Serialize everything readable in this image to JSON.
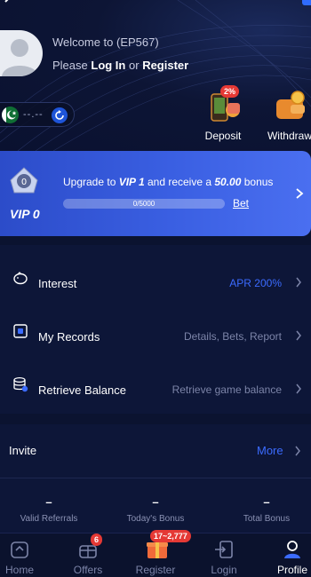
{
  "header": {
    "welcome": "Welcome to (EP567)",
    "please": "Please",
    "login": "Log In",
    "or": "or",
    "register": "Register",
    "balance": "--.--",
    "actions": [
      {
        "label": "Deposit",
        "badge": "2%"
      },
      {
        "label": "Withdraw"
      }
    ]
  },
  "vip": {
    "level": "VIP 0",
    "text_prefix": "Upgrade to",
    "next_level": "VIP 1",
    "text_mid": "and receive a",
    "bonus": "50.00",
    "text_suffix": "bonus",
    "progress_text": "0/5000",
    "progress_fraction": 0.0,
    "bet_label": "Bet"
  },
  "menu": [
    {
      "label": "Interest",
      "value": "APR 200%",
      "accent": true
    },
    {
      "label": "My Records",
      "value": "Details, Bets, Report",
      "accent": false
    },
    {
      "label": "Retrieve Balance",
      "value": "Retrieve game balance",
      "accent": false
    }
  ],
  "invite": {
    "title": "Invite",
    "more": "More",
    "stats": [
      {
        "value": "–",
        "label": "Valid Referrals"
      },
      {
        "value": "–",
        "label": "Today's Bonus"
      },
      {
        "value": "–",
        "label": "Total Bonus"
      }
    ]
  },
  "nav": [
    {
      "label": "Home",
      "icon": "home-icon"
    },
    {
      "label": "Offers",
      "icon": "gift-box-icon",
      "badge": "6"
    },
    {
      "label": "Register",
      "icon": "present-icon",
      "badge": "17~2,777"
    },
    {
      "label": "Login",
      "icon": "login-icon"
    },
    {
      "label": "Profile",
      "icon": "profile-icon",
      "active": true
    }
  ],
  "colors": {
    "background": "#0b1330",
    "accent": "#3b6bff",
    "vip_card": "#3a5fe2",
    "badge": "#e53935"
  }
}
